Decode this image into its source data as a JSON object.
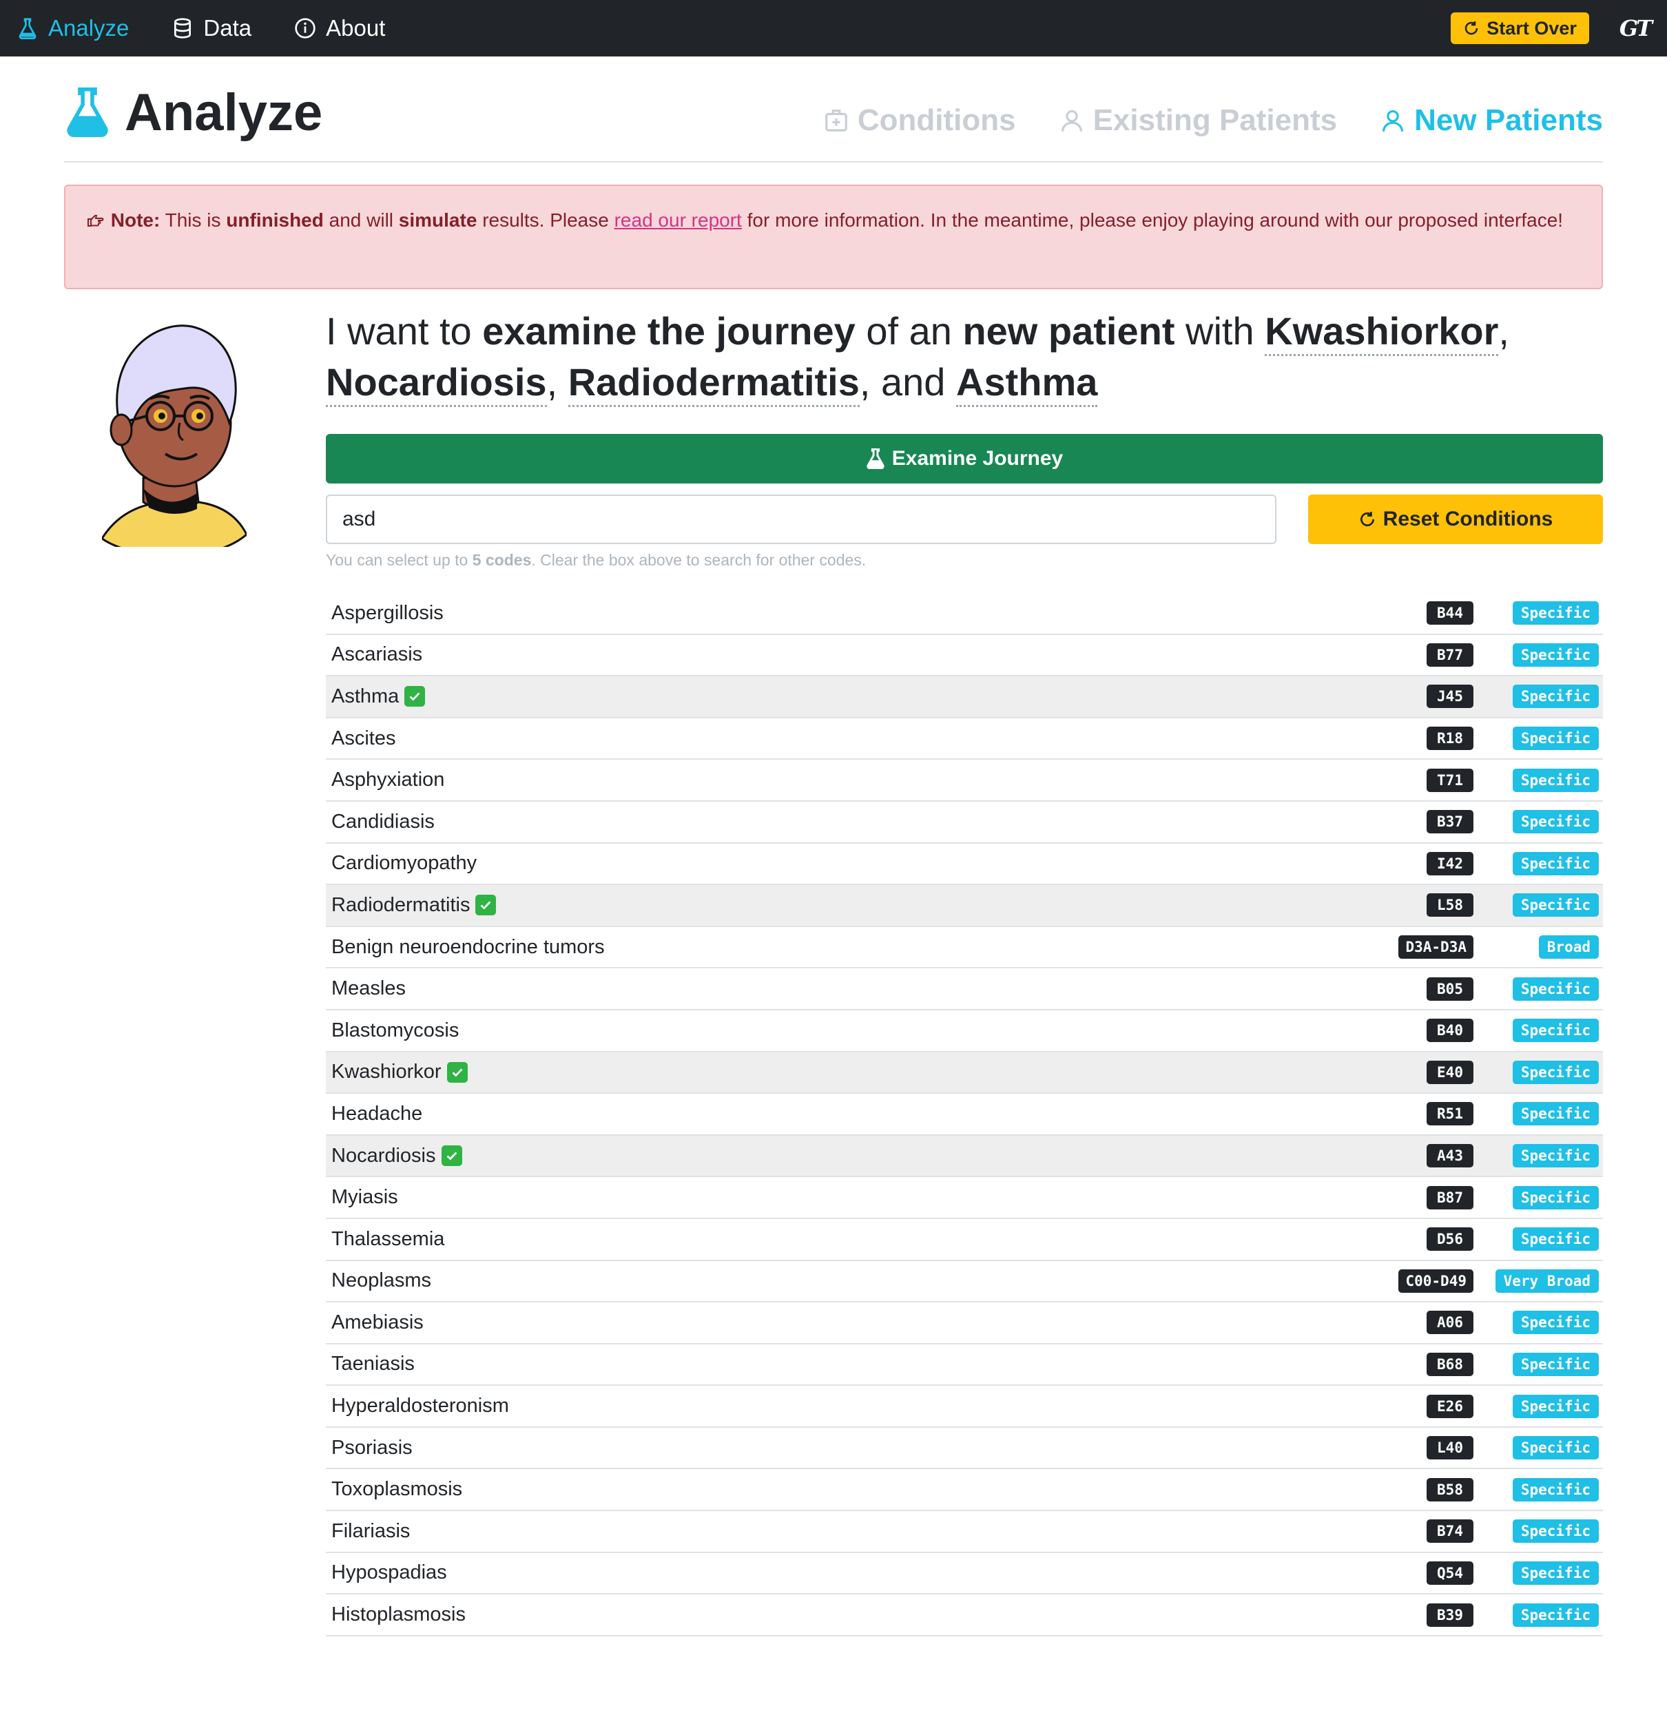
{
  "nav": {
    "items": [
      {
        "label": "Analyze",
        "icon": "flask-icon",
        "active": true
      },
      {
        "label": "Data",
        "icon": "database-icon",
        "active": false
      },
      {
        "label": "About",
        "icon": "info-icon",
        "active": false
      }
    ],
    "start_over": "Start Over",
    "logo": "GT"
  },
  "header": {
    "title": "Analyze",
    "tabs": [
      {
        "label": "Conditions",
        "icon": "hospital-plus-icon",
        "active": false
      },
      {
        "label": "Existing Patients",
        "icon": "person-icon",
        "active": false
      },
      {
        "label": "New Patients",
        "icon": "person-icon",
        "active": true
      }
    ]
  },
  "alert": {
    "note": "Note:",
    "t1": "This is",
    "b1": "unfinished",
    "t2": "and will",
    "b2": "simulate",
    "t3": "results. Please",
    "link": "read our report",
    "t4": "for more information. In the meantime, please enjoy playing around with our proposed interface!"
  },
  "sentence": {
    "s1": "I want to",
    "b1": "examine the journey",
    "s2": "of an",
    "b2": "new patient",
    "s3": "with",
    "c1": "Kwashiorkor",
    "c2": "Nocardiosis",
    "c3": "Radiodermatitis",
    "s4": ", and",
    "c4": "Asthma"
  },
  "examine_label": "Examine Journey",
  "search": {
    "value": "asd"
  },
  "reset_label": "Reset Conditions",
  "hint": {
    "t1": "You can select up to",
    "b": "5 codes",
    "t2": ". Clear the box above to search for other codes."
  },
  "colors": {
    "accent": "#1fbfe6",
    "success": "#198754",
    "warning": "#ffc107",
    "dark": "#212529",
    "alert_bg": "#f8d7da"
  },
  "results": [
    {
      "name": "Aspergillosis",
      "code": "B44",
      "specificity": "Specific",
      "selected": false
    },
    {
      "name": "Ascariasis",
      "code": "B77",
      "specificity": "Specific",
      "selected": false
    },
    {
      "name": "Asthma",
      "code": "J45",
      "specificity": "Specific",
      "selected": true
    },
    {
      "name": "Ascites",
      "code": "R18",
      "specificity": "Specific",
      "selected": false
    },
    {
      "name": "Asphyxiation",
      "code": "T71",
      "specificity": "Specific",
      "selected": false
    },
    {
      "name": "Candidiasis",
      "code": "B37",
      "specificity": "Specific",
      "selected": false
    },
    {
      "name": "Cardiomyopathy",
      "code": "I42",
      "specificity": "Specific",
      "selected": false
    },
    {
      "name": "Radiodermatitis",
      "code": "L58",
      "specificity": "Specific",
      "selected": true
    },
    {
      "name": "Benign neuroendocrine tumors",
      "code": "D3A-D3A",
      "specificity": "Broad",
      "selected": false
    },
    {
      "name": "Measles",
      "code": "B05",
      "specificity": "Specific",
      "selected": false
    },
    {
      "name": "Blastomycosis",
      "code": "B40",
      "specificity": "Specific",
      "selected": false
    },
    {
      "name": "Kwashiorkor",
      "code": "E40",
      "specificity": "Specific",
      "selected": true
    },
    {
      "name": "Headache",
      "code": "R51",
      "specificity": "Specific",
      "selected": false
    },
    {
      "name": "Nocardiosis",
      "code": "A43",
      "specificity": "Specific",
      "selected": true
    },
    {
      "name": "Myiasis",
      "code": "B87",
      "specificity": "Specific",
      "selected": false
    },
    {
      "name": "Thalassemia",
      "code": "D56",
      "specificity": "Specific",
      "selected": false
    },
    {
      "name": "Neoplasms",
      "code": "C00-D49",
      "specificity": "Very Broad",
      "selected": false
    },
    {
      "name": "Amebiasis",
      "code": "A06",
      "specificity": "Specific",
      "selected": false
    },
    {
      "name": "Taeniasis",
      "code": "B68",
      "specificity": "Specific",
      "selected": false
    },
    {
      "name": "Hyperaldosteronism",
      "code": "E26",
      "specificity": "Specific",
      "selected": false
    },
    {
      "name": "Psoriasis",
      "code": "L40",
      "specificity": "Specific",
      "selected": false
    },
    {
      "name": "Toxoplasmosis",
      "code": "B58",
      "specificity": "Specific",
      "selected": false
    },
    {
      "name": "Filariasis",
      "code": "B74",
      "specificity": "Specific",
      "selected": false
    },
    {
      "name": "Hypospadias",
      "code": "Q54",
      "specificity": "Specific",
      "selected": false
    },
    {
      "name": "Histoplasmosis",
      "code": "B39",
      "specificity": "Specific",
      "selected": false
    }
  ]
}
